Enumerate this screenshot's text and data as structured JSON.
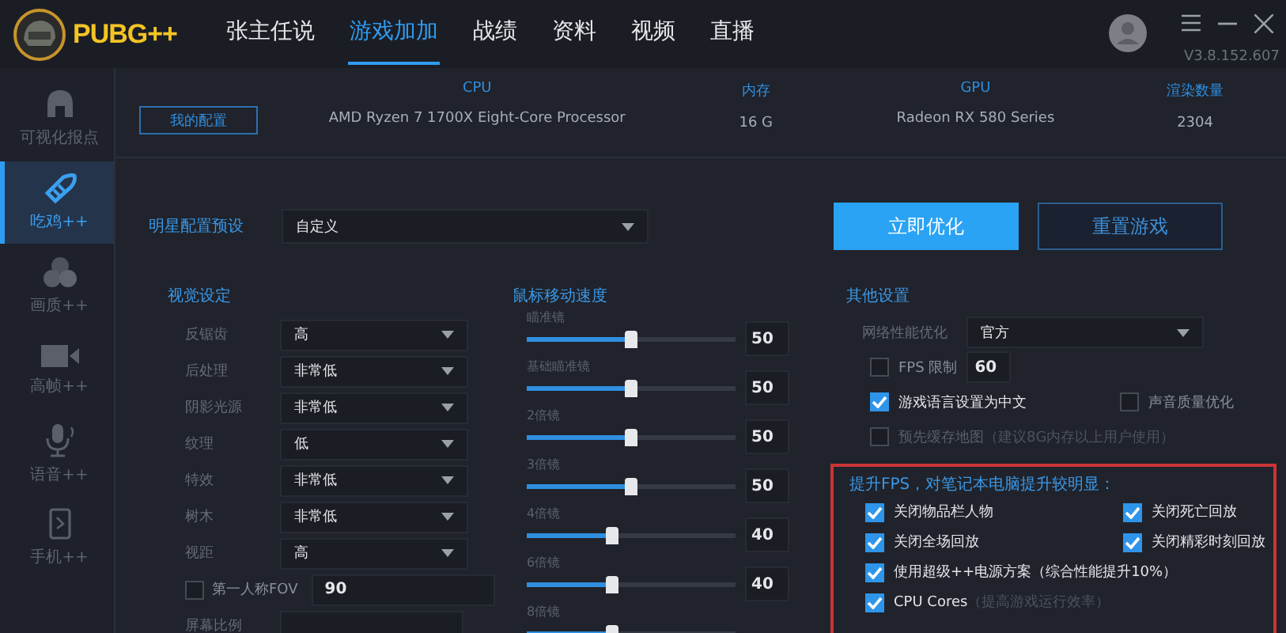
{
  "logo": {
    "title": "PUBG++"
  },
  "nav": [
    {
      "label": "张主任说",
      "selected": false
    },
    {
      "label": "游戏加加",
      "selected": true
    },
    {
      "label": "战绩",
      "selected": false
    },
    {
      "label": "资料",
      "selected": false
    },
    {
      "label": "视频",
      "selected": false
    },
    {
      "label": "直播",
      "selected": false
    }
  ],
  "version": "V3.8.152.607",
  "sidebar": [
    {
      "label": "可视化报点",
      "kind": "helmet",
      "selected": false
    },
    {
      "label": "吃鸡++",
      "kind": "rocket",
      "selected": true
    },
    {
      "label": "画质++",
      "kind": "circles",
      "selected": false
    },
    {
      "label": "高帧++",
      "kind": "camera",
      "selected": false
    },
    {
      "label": "语音++",
      "kind": "mic",
      "selected": false
    },
    {
      "label": "手机++",
      "kind": "phone",
      "selected": false
    }
  ],
  "hardware": {
    "button": "我的配置",
    "columns": [
      {
        "heading": "CPU",
        "value": "AMD Ryzen 7 1700X Eight-Core Processor"
      },
      {
        "heading": "内存",
        "value": "16 G"
      },
      {
        "heading": "GPU",
        "value": "Radeon RX 580 Series"
      },
      {
        "heading": "渲染数量",
        "value": "2304"
      }
    ]
  },
  "preset": {
    "label": "明星配置预设",
    "value": "自定义"
  },
  "actions": [
    {
      "label": "立即优化",
      "kind": "primary"
    },
    {
      "label": "重置游戏",
      "kind": "secondary"
    }
  ],
  "visual": {
    "title": "视觉设定",
    "rows": [
      {
        "label": "反锯齿",
        "value": "高"
      },
      {
        "label": "后处理",
        "value": "非常低"
      },
      {
        "label": "阴影光源",
        "value": "非常低"
      },
      {
        "label": "纹理",
        "value": "低"
      },
      {
        "label": "特效",
        "value": "非常低"
      },
      {
        "label": "树木",
        "value": "非常低"
      },
      {
        "label": "视距",
        "value": "高"
      }
    ],
    "fov": {
      "label": "第一人称FOV",
      "checked": false,
      "value": "90"
    },
    "next_label": "屏幕比例"
  },
  "mouse": {
    "title": "鼠标移动速度",
    "sliders": [
      {
        "label": "瞄准镜",
        "level": 0.5,
        "reading": "50"
      },
      {
        "label": "基础瞄准镜",
        "level": 0.5,
        "reading": "50"
      },
      {
        "label": "2倍镜",
        "level": 0.5,
        "reading": "50"
      },
      {
        "label": "3倍镜",
        "level": 0.5,
        "reading": "50"
      },
      {
        "label": "4倍镜",
        "level": 0.4,
        "reading": "40"
      },
      {
        "label": "6倍镜",
        "level": 0.4,
        "reading": "40"
      },
      {
        "label": "8倍镜",
        "level": 0.4
      }
    ]
  },
  "other": {
    "title": "其他设置",
    "network": {
      "label": "网络性能优化",
      "value": "官方"
    },
    "fps": {
      "label": "FPS 限制",
      "checked": false,
      "value": "60"
    },
    "options": [
      {
        "label": "游戏语言设置为中文",
        "checked": true,
        "disabled": false
      },
      {
        "label": "声音质量优化",
        "checked": false,
        "disabled": false
      },
      {
        "label": "预先缓存地图",
        "note": "（建议8G内存以上用户使用）",
        "checked": false,
        "disabled": true
      }
    ]
  },
  "fps_boost": {
    "title": "提升FPS，对笔记本电脑提升较明显：",
    "options": [
      {
        "label": "关闭物品栏人物",
        "checked": true,
        "wide": false
      },
      {
        "label": "关闭死亡回放",
        "checked": true,
        "wide": false
      },
      {
        "label": "关闭全场回放",
        "checked": true,
        "wide": false
      },
      {
        "label": "关闭精彩时刻回放",
        "checked": true,
        "wide": false
      },
      {
        "label": "使用超级++电源方案（综合性能提升10%）",
        "checked": true,
        "wide": true
      },
      {
        "label": "CPU Cores",
        "note": "（提高游戏运行效率）",
        "checked": true,
        "wide": true
      }
    ]
  }
}
